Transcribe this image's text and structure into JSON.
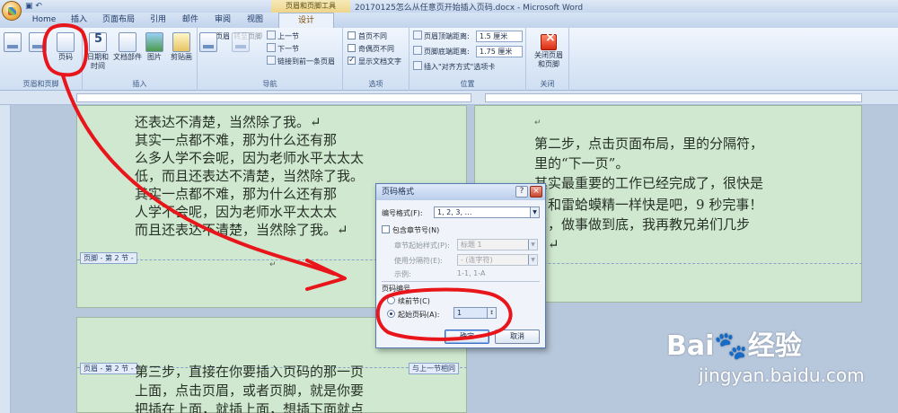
{
  "window": {
    "title": "20170125怎么从任意页开始插入页码.docx - Microsoft Word",
    "context_tab": "页眉和页脚工具"
  },
  "tabs": [
    "Home",
    "插入",
    "页面布局",
    "引用",
    "邮件",
    "审阅",
    "视图",
    "设计"
  ],
  "ribbon": {
    "groups": [
      "页眉和页脚",
      "插入",
      "导航",
      "选项",
      "位置",
      "关闭"
    ],
    "header_footer": {
      "header": "页眉",
      "footer": "页脚",
      "page_number": "页码"
    },
    "insert": {
      "datetime_1": "日期和",
      "datetime_2": "时间",
      "quickparts": "文档部件",
      "picture": "图片",
      "clipart": "剪贴画"
    },
    "navigation": {
      "goto_header": "转至页眉",
      "goto_footer": "转至页脚",
      "prev": "上一节",
      "next": "下一节",
      "link_prev": "链接到前一条页眉"
    },
    "options": {
      "diff_first": "首页不同",
      "diff_odd_even": "奇偶页不同",
      "show_text": "显示文档文字",
      "show_text_checked": true
    },
    "position": {
      "header_top_label": "页眉顶端距离:",
      "header_top_value": "1.5 厘米",
      "footer_bottom_label": "页脚底端距离:",
      "footer_bottom_value": "1.75 厘米",
      "insert_align": "插入\"对齐方式\"选项卡"
    },
    "close": {
      "label_1": "关闭页眉",
      "label_2": "和页脚"
    }
  },
  "document": {
    "left_page_lines": [
      "还表达不清楚，当然除了我。↵",
      "    其实一点都不难，那为什么还有那",
      "么多人学不会呢，因为老师水平太太太",
      "低，而且还表达不清楚，当然除了我。",
      "其实一点都不难，那为什么还有那",
      "人学不会呢，因为老师水平太太太",
      "而且还表达不清楚，当然除了我。↵"
    ],
    "footer_tag": "页脚 - 第 2 节 -",
    "right_page_lines": [
      "第二步，点击页面布局，里的分隔符，",
      "里的“下一页”。",
      "其实最重要的工作已经完成了，很快是",
      "，和雷蛤蟆精一样快是吧，9 秒完事！",
      "了，做事做到底，我再教兄弟们几步",
      "。↵"
    ],
    "header_tag": "页眉 - 第 2 节 -",
    "same_as_prev": "与上一节相同",
    "bottom_page_lines": [
      "第三步，直接在你要插入页码的那一页",
      "上面，点击页眉，或者页脚，就是你要",
      "把插在上面，就插上面，想插下面就点"
    ]
  },
  "dialog": {
    "title": "页码格式",
    "number_format_label": "编号格式(F):",
    "number_format_value": "1, 2, 3, …",
    "include_chapter": "包含章节号(N)",
    "chapter_style_label": "章节起始样式(P):",
    "chapter_style_value": "标题 1",
    "separator_label": "使用分隔符(E):",
    "separator_value": "-  (连字符)",
    "example_label": "示例:",
    "example_value": "1-1, 1-A",
    "page_numbering": "页码编号",
    "continue_label": "续前节(C)",
    "start_at_label": "起始页码(A):",
    "start_at_value": "1",
    "ok": "确定",
    "cancel": "取消"
  },
  "watermark": {
    "brand": "Bai",
    "brand_cn": "经验",
    "url": "jingyan.baidu.com"
  },
  "colors": {
    "annotation": "#e8151b",
    "page_bg": "#cfe8cf",
    "workspace": "#b7c7dc"
  }
}
